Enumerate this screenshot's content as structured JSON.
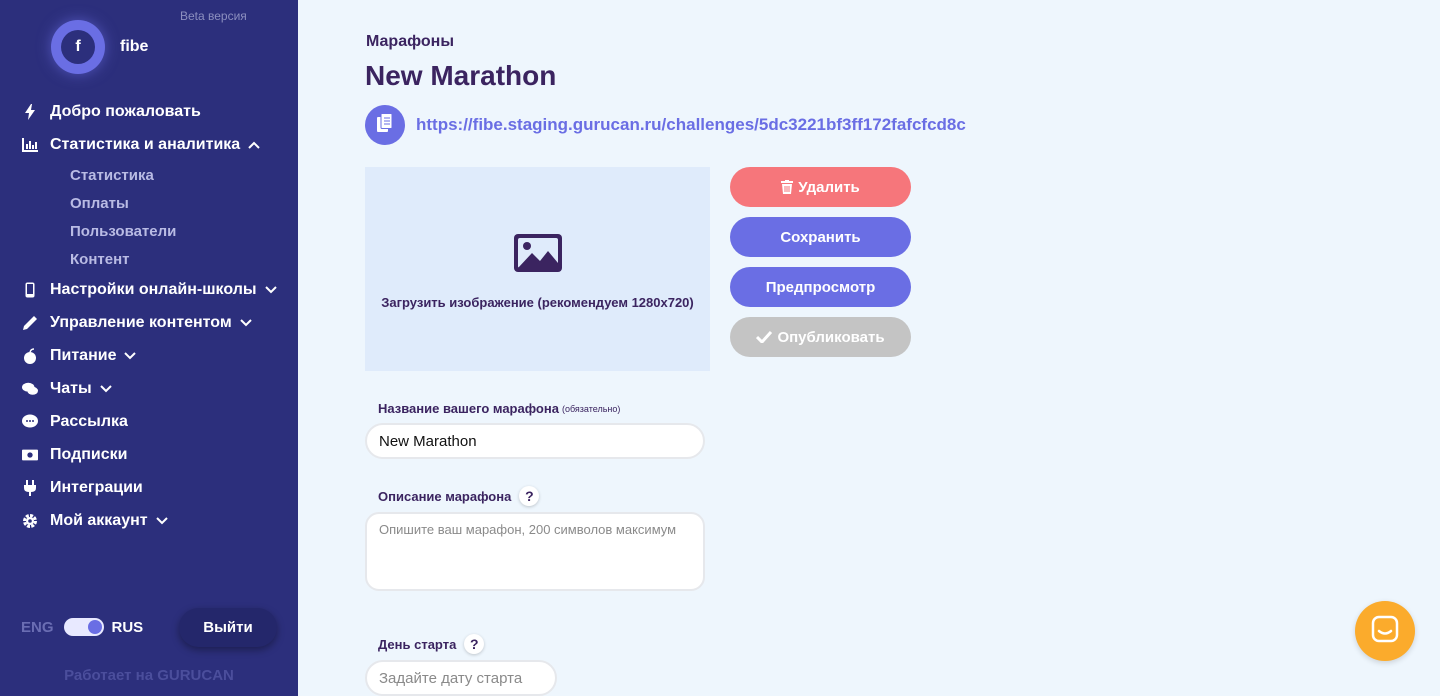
{
  "sidebar": {
    "beta_label": "Beta версия",
    "logo_letter": "f",
    "brand_name": "fibe",
    "items": [
      {
        "label": "Добро пожаловать",
        "icon": "bolt-icon"
      },
      {
        "label": "Статистика и аналитика",
        "icon": "chart-icon",
        "expanded": true,
        "children": [
          "Статистика",
          "Оплаты",
          "Пользователи",
          "Контент"
        ]
      },
      {
        "label": "Настройки онлайн-школы",
        "icon": "mobile-icon"
      },
      {
        "label": "Управление контентом",
        "icon": "pencil-icon"
      },
      {
        "label": "Питание",
        "icon": "apple-icon"
      },
      {
        "label": "Чаты",
        "icon": "chats-icon"
      },
      {
        "label": "Рассылка",
        "icon": "comment-icon"
      },
      {
        "label": "Подписки",
        "icon": "money-icon"
      },
      {
        "label": "Интеграции",
        "icon": "plug-icon"
      },
      {
        "label": "Мой аккаунт",
        "icon": "gear-icon"
      }
    ],
    "lang_off": "ENG",
    "lang_on": "RUS",
    "logout_label": "Выйти",
    "powered_by": "Работает на GURUCAN"
  },
  "main": {
    "breadcrumb": "Марафоны",
    "title": "New Marathon",
    "link": "https://fibe.staging.gurucan.ru/challenges/5dc3221bf3ff172fafcfcd8c",
    "upload_text": "Загрузить изображение (рекомендуем 1280x720)",
    "buttons": {
      "delete": "Удалить",
      "save": "Сохранить",
      "preview": "Предпросмотр",
      "publish": "Опубликовать"
    },
    "name_label": "Название вашего марафона",
    "name_required": "(обязательно)",
    "name_value": "New Marathon",
    "desc_label": "Описание марафона",
    "desc_placeholder": "Опишите ваш марафон, 200 символов максимум",
    "start_label": "День старта",
    "start_placeholder": "Задайте дату старта",
    "help_glyph": "?"
  },
  "colors": {
    "sidebar_bg": "#2c2f7c",
    "accent": "#6a6ee4",
    "danger": "#f6767b",
    "disabled": "#c4c4c4",
    "title": "#3b2460",
    "chat_fab": "#fbab2c"
  }
}
